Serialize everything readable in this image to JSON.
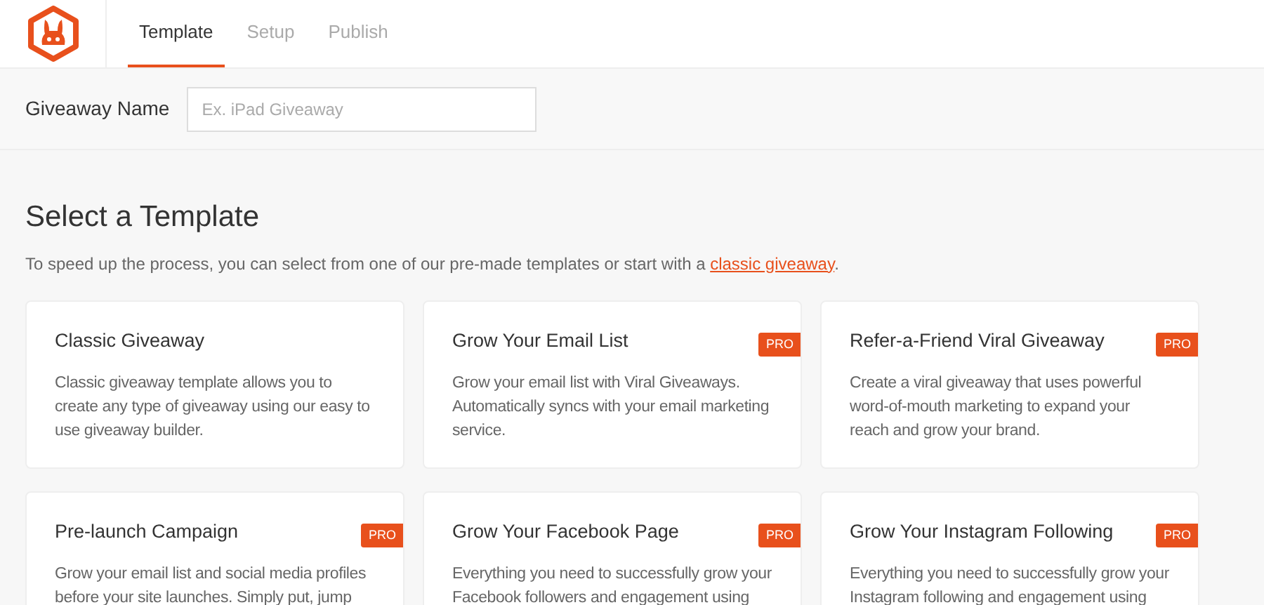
{
  "tabs": [
    {
      "label": "Template",
      "selected": true
    },
    {
      "label": "Setup",
      "selected": false
    },
    {
      "label": "Publish",
      "selected": false
    }
  ],
  "giveaway_name": {
    "label": "Giveaway Name",
    "placeholder": "Ex. iPad Giveaway"
  },
  "section": {
    "title": "Select a Template",
    "intro": "To speed up the process, you can select from one of our pre-made templates or start with a",
    "link": "classic giveaway",
    "after": "."
  },
  "templates": [
    {
      "title": "Classic Giveaway",
      "pro": false,
      "description": "Classic giveaway template allows you to create any type of giveaway using our easy to use giveaway builder."
    },
    {
      "title": "Grow Your Email List",
      "pro": true,
      "badge": "PRO",
      "description": "Grow your email list with Viral Giveaways. Automatically syncs with your email marketing service."
    },
    {
      "title": "Refer-a-Friend Viral Giveaway",
      "pro": true,
      "badge": "PRO",
      "description": "Create a viral giveaway that uses powerful word-of-mouth marketing to expand your reach and grow your brand."
    },
    {
      "title": "Pre-launch Campaign",
      "pro": true,
      "badge": "PRO",
      "description": "Grow your email list and social media profiles before your site launches. Simply put, jump"
    },
    {
      "title": "Grow Your Facebook Page",
      "pro": true,
      "badge": "PRO",
      "description": "Everything you need to successfully grow your Facebook followers and engagement using"
    },
    {
      "title": "Grow Your Instagram Following",
      "pro": true,
      "badge": "PRO",
      "description": "Everything you need to successfully grow your Instagram following and engagement using"
    }
  ]
}
